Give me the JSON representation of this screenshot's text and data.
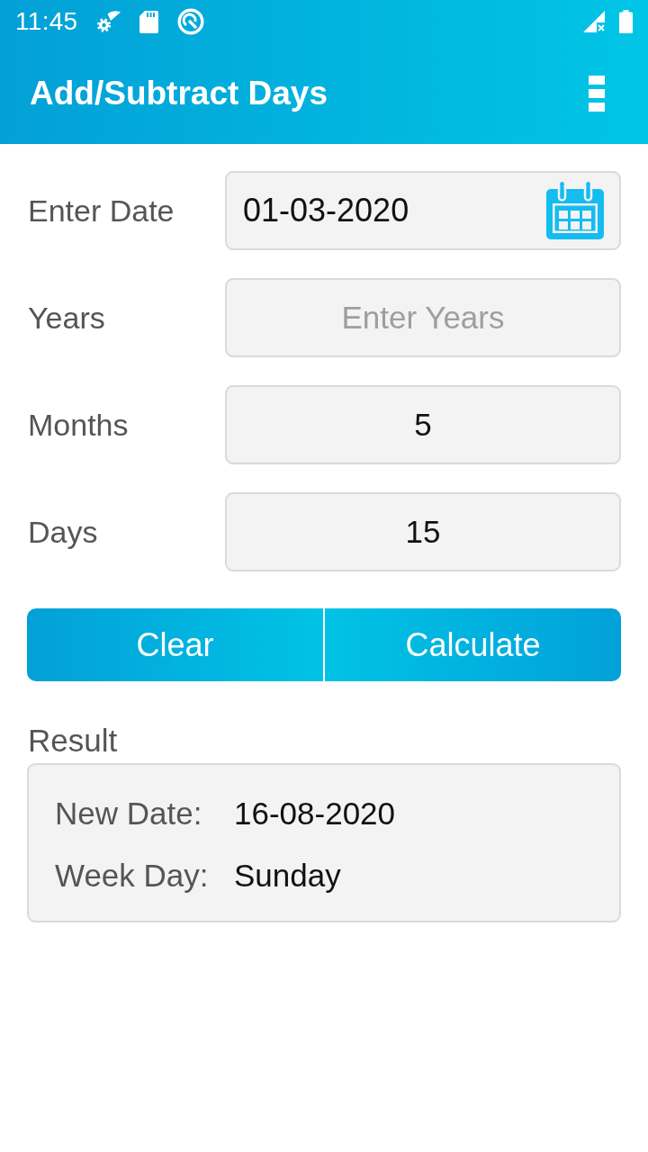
{
  "status_bar": {
    "time": "11:45"
  },
  "app_bar": {
    "title": "Add/Subtract Days"
  },
  "form": [
    {
      "kind": "date",
      "label": "Enter Date",
      "value": "01-03-2020"
    },
    {
      "kind": "number",
      "label": "Years",
      "placeholder": "Enter Years"
    },
    {
      "kind": "number",
      "label": "Months",
      "value": "5"
    },
    {
      "kind": "number",
      "label": "Days",
      "value": "15"
    }
  ],
  "buttons": [
    "Clear",
    "Calculate"
  ],
  "result": {
    "title": "Result",
    "rows": [
      {
        "label": "New Date:",
        "value": "16-08-2020"
      },
      {
        "label": "Week Day:",
        "value": "Sunday"
      }
    ]
  }
}
